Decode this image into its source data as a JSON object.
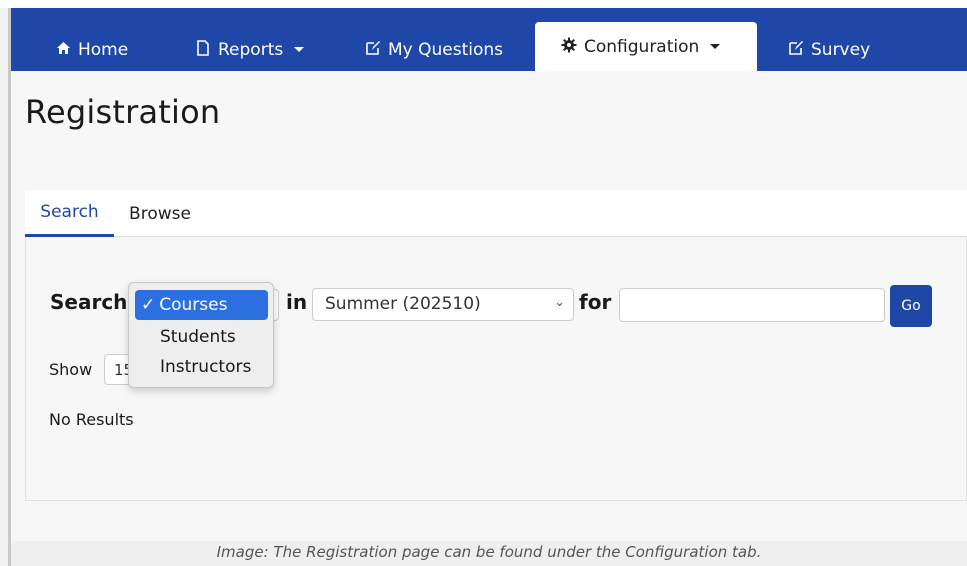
{
  "nav": {
    "items": [
      {
        "label": "Home",
        "icon": "home-icon"
      },
      {
        "label": "Reports",
        "icon": "document-icon",
        "has_caret": true
      },
      {
        "label": "My Questions",
        "icon": "edit-icon"
      },
      {
        "label": "Configuration",
        "icon": "gear-icon",
        "has_caret": true,
        "active": true
      },
      {
        "label": "Survey",
        "icon": "edit-icon"
      }
    ]
  },
  "page": {
    "title": "Registration"
  },
  "tabs": [
    {
      "label": "Search",
      "active": true
    },
    {
      "label": "Browse",
      "active": false
    }
  ],
  "search": {
    "search_label": "Search",
    "type_options": [
      "Courses",
      "Students",
      "Instructors"
    ],
    "type_selected": "Courses",
    "in_label": "in",
    "term_value": "Summer (202510)",
    "for_label": "for",
    "query_value": "",
    "go_label": "Go"
  },
  "show": {
    "label": "Show",
    "value": "15"
  },
  "results": {
    "message": "No Results"
  },
  "caption": "Image: The Registration page can be found under the Configuration tab.",
  "colors": {
    "navbar": "#1e47a8",
    "accent": "#1e47a8",
    "dropdown_selected": "#2c6fe0"
  }
}
